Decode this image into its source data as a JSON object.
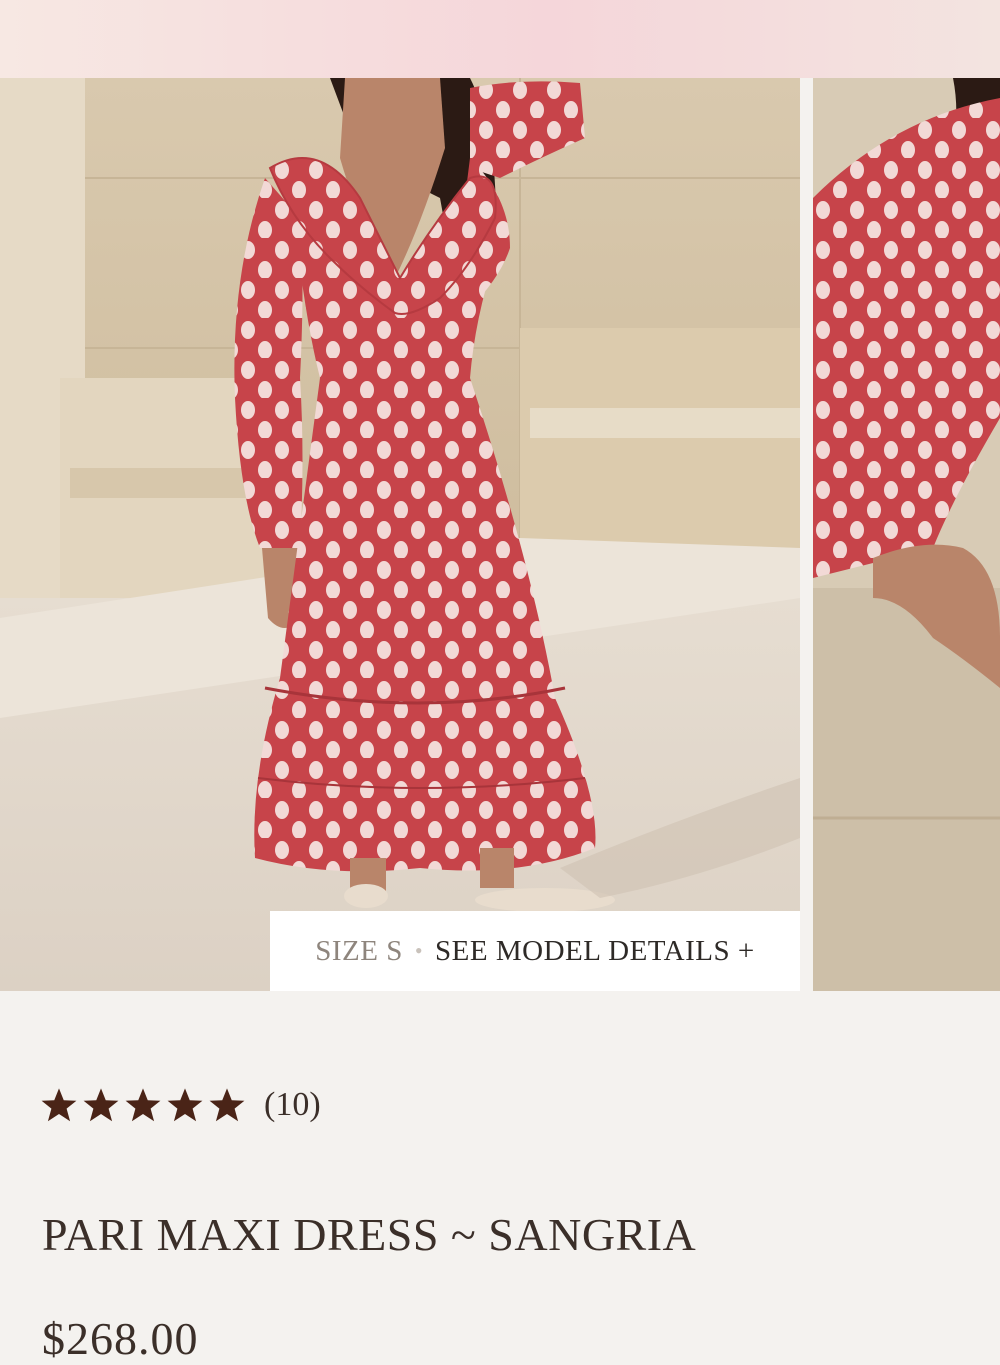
{
  "gallery": {
    "model_size": "SIZE S",
    "separator": "•",
    "model_details_link": "SEE MODEL DETAILS +"
  },
  "product": {
    "rating": 5,
    "review_count": "(10)",
    "title": "PARI MAXI DRESS ~ SANGRIA",
    "price": "$268.00"
  },
  "colors": {
    "background": "#f4f2ef",
    "banner_pink": "#f5d6da",
    "dress_red": "#c7444a",
    "star": "#4a2417",
    "text": "#3b2f29"
  }
}
